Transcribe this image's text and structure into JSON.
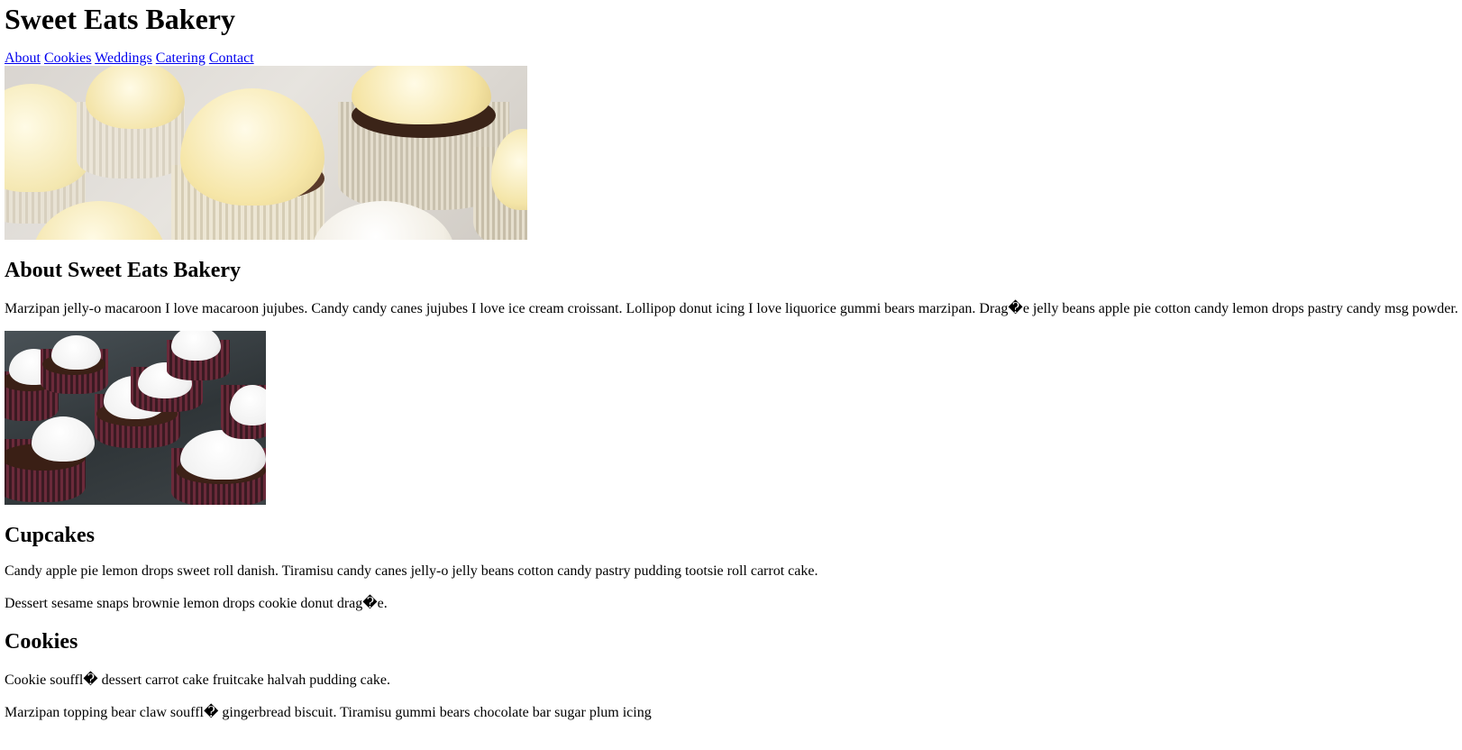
{
  "site": {
    "title": "Sweet Eats Bakery"
  },
  "nav": {
    "items": [
      {
        "label": "About"
      },
      {
        "label": "Cookies"
      },
      {
        "label": "Weddings"
      },
      {
        "label": "Catering"
      },
      {
        "label": "Contact"
      }
    ]
  },
  "hero": {
    "image": "cupcakes-vanilla-frosting-banner"
  },
  "about": {
    "heading": "About Sweet Eats Bakery",
    "paragraph": "Marzipan jelly-o macaroon I love macaroon jujubes. Candy candy canes jujubes I love ice cream croissant. Lollipop donut icing I love liquorice gummi bears marzipan. Drag�e jelly beans apple pie cotton candy lemon drops pastry candy msg powder.",
    "image": "chocolate-cupcakes-white-frosting"
  },
  "cupcakes": {
    "heading": "Cupcakes",
    "paragraph1": "Candy apple pie lemon drops sweet roll danish. Tiramisu candy canes jelly-o jelly beans cotton candy pastry pudding tootsie roll carrot cake.",
    "paragraph2": "Dessert sesame snaps brownie lemon drops cookie donut drag�e."
  },
  "cookies": {
    "heading": "Cookies",
    "paragraph1": "Cookie souffl� dessert carrot cake fruitcake halvah pudding cake.",
    "paragraph2": "Marzipan topping bear claw souffl� gingerbread biscuit. Tiramisu gummi bears chocolate bar sugar plum icing"
  },
  "colors": {
    "link": "#0000ee",
    "text": "#000000",
    "background": "#ffffff"
  }
}
